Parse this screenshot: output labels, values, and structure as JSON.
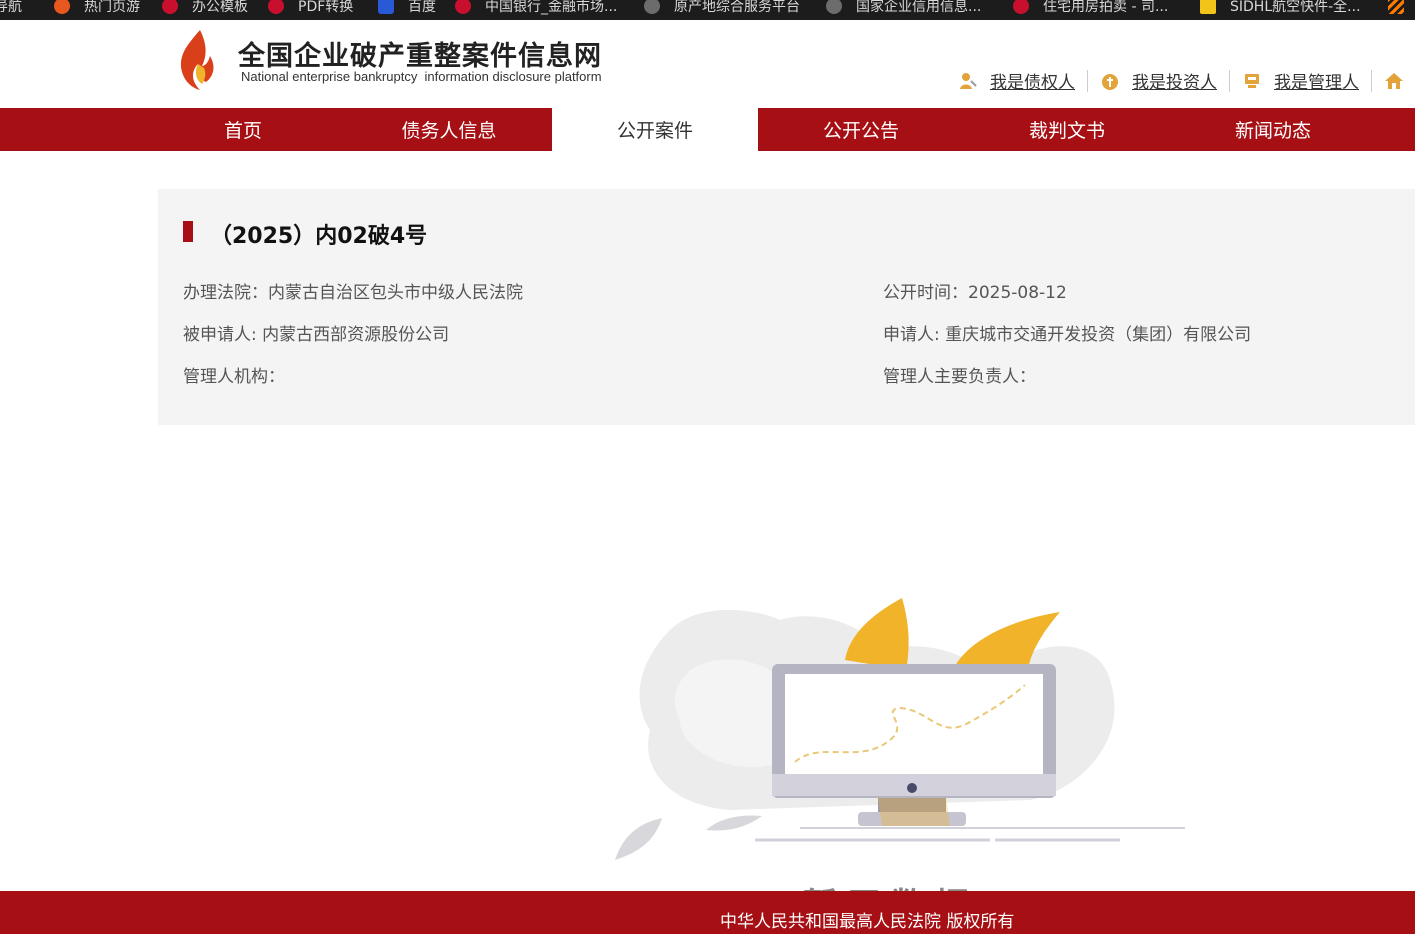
{
  "bookmarks": [
    {
      "label": "导航",
      "icon": "orange-logo-icon"
    },
    {
      "label": "热门页游",
      "icon": "orange-logo-icon"
    },
    {
      "label": "办公模板",
      "icon": "red-logo-icon"
    },
    {
      "label": "PDF转换",
      "icon": "red-logo-icon"
    },
    {
      "label": "百度",
      "icon": "baidu-icon"
    },
    {
      "label": "中国银行_金融市场...",
      "icon": "boc-icon"
    },
    {
      "label": "原产地综合服务平台",
      "icon": "globe-icon"
    },
    {
      "label": "国家企业信用信息...",
      "icon": "globe-icon"
    },
    {
      "label": "住宅用房拍卖 - 司...",
      "icon": "auction-icon"
    },
    {
      "label": "SIDHL航空快件-全...",
      "icon": "dhl-icon"
    }
  ],
  "header": {
    "title": "全国企业破产重整案件信息网",
    "subtitle": "National enterprise bankruptcy  information disclosure platform",
    "roles": [
      {
        "label": "我是债权人",
        "icon": "creditor-icon"
      },
      {
        "label": "我是投资人",
        "icon": "investor-icon"
      },
      {
        "label": "我是管理人",
        "icon": "manager-icon"
      }
    ]
  },
  "nav": {
    "items": [
      "首页",
      "债务人信息",
      "公开案件",
      "公开公告",
      "裁判文书",
      "新闻动态"
    ],
    "active_index": 2
  },
  "case": {
    "title": "（2025）内02破4号",
    "court_label": "办理法院：",
    "court_value": "内蒙古自治区包头市中级人民法院",
    "date_label": "公开时间：",
    "date_value": "2025-08-12",
    "respondent_label": "被申请人: ",
    "respondent_value": "内蒙古西部资源股份公司",
    "applicant_label": "申请人: ",
    "applicant_value": "重庆城市交通开发投资（集团）有限公司",
    "admin_org_label": "管理人机构：",
    "admin_org_value": "",
    "admin_head_label": "管理人主要负责人：",
    "admin_head_value": ""
  },
  "empty": {
    "text": "暂无数据"
  },
  "footer": {
    "copyright": "中华人民共和国最高人民法院 版权所有"
  },
  "colors": {
    "brand_red": "#a61015",
    "card_bg": "#f4f4f4",
    "flame_yellow": "#f0b32a"
  }
}
